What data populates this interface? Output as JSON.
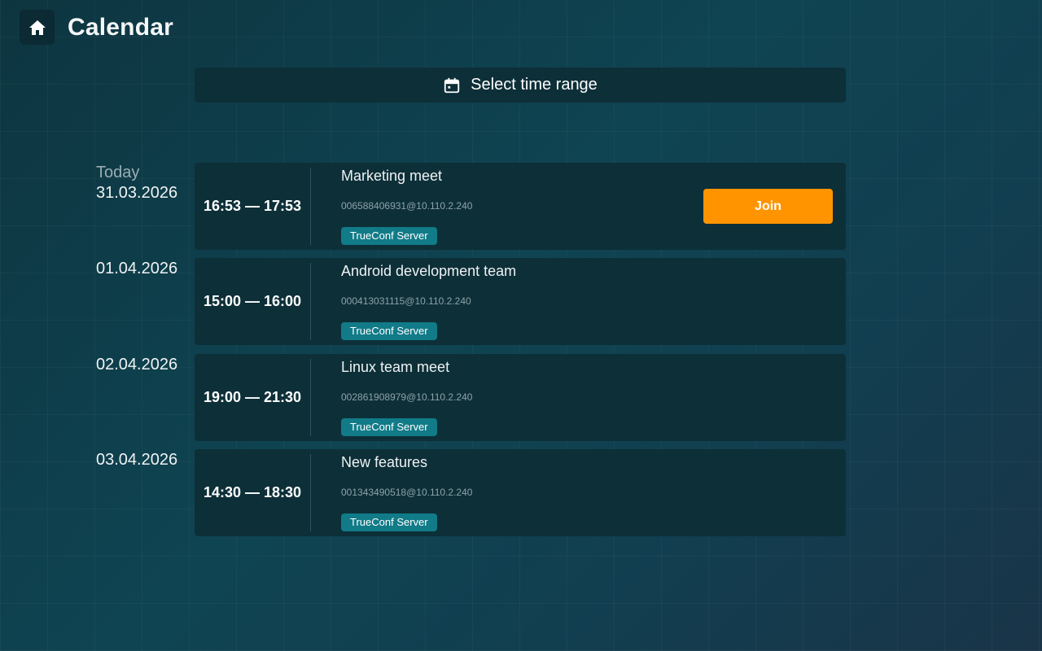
{
  "header": {
    "title": "Calendar",
    "home_icon": "home-icon"
  },
  "toolbar": {
    "select_range_label": "Select time range",
    "calendar_icon": "calendar-icon"
  },
  "days": [
    {
      "today_label": "Today",
      "date": "31.03.2026",
      "event": {
        "time": "16:53 — 17:53",
        "title": "Marketing meet",
        "address": "006588406931@10.110.2.240",
        "server": "TrueConf Server",
        "join_label": "Join"
      }
    },
    {
      "date": "01.04.2026",
      "event": {
        "time": "15:00 — 16:00",
        "title": "Android development team",
        "address": "000413031115@10.110.2.240",
        "server": "TrueConf Server"
      }
    },
    {
      "date": "02.04.2026",
      "event": {
        "time": "19:00 — 21:30",
        "title": "Linux team meet",
        "address": "002861908979@10.110.2.240",
        "server": "TrueConf Server"
      }
    },
    {
      "date": "03.04.2026",
      "event": {
        "time": "14:30 — 18:30",
        "title": "New features",
        "address": "001343490518@10.110.2.240",
        "server": "TrueConf Server"
      }
    }
  ],
  "colors": {
    "accent": "#ff9400",
    "badge": "#117b88",
    "card": "#0d2f38"
  }
}
